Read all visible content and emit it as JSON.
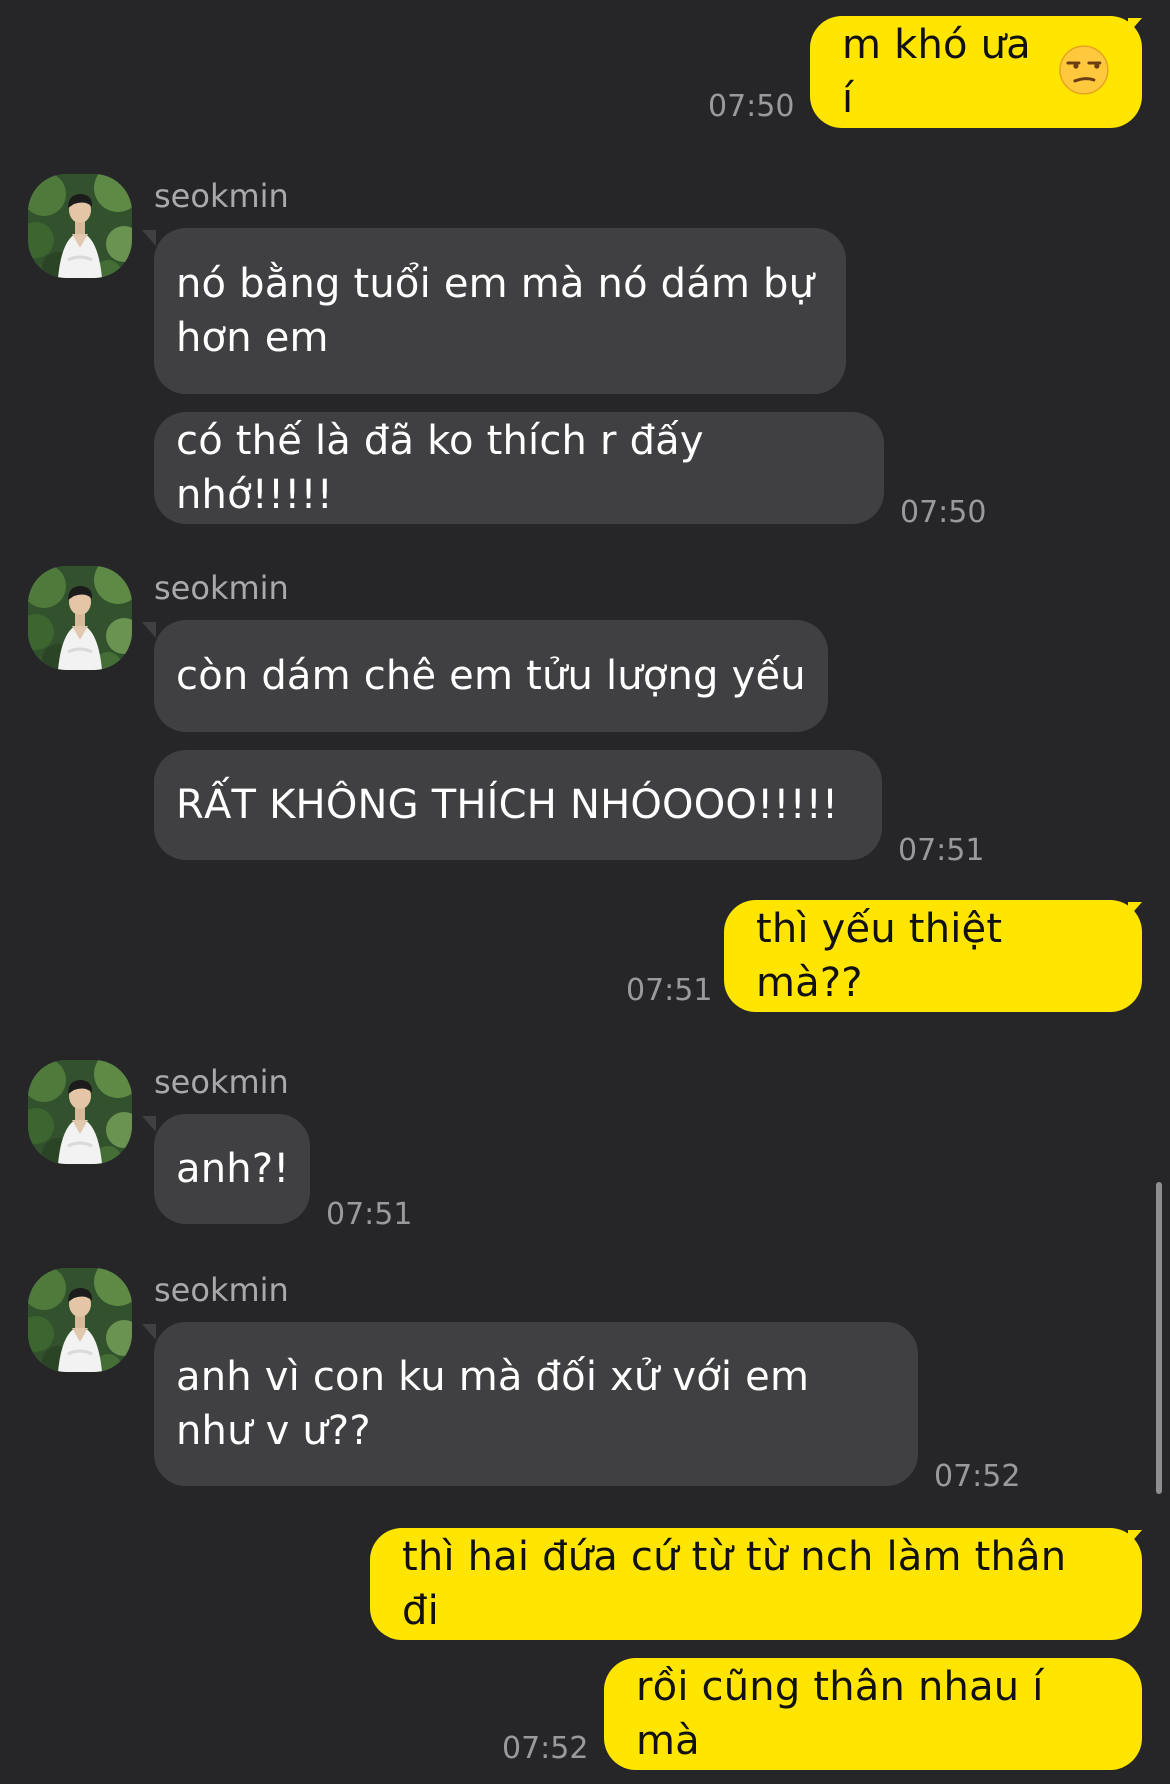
{
  "contact": {
    "name": "seokmin",
    "avatar_icon": "profile-photo-man-white-shirt"
  },
  "colors": {
    "background": "#262628",
    "incoming_bubble": "#404042",
    "outgoing_bubble": "#ffe500",
    "timestamp": "#9a9a9c"
  },
  "messages": [
    {
      "from": "me",
      "text": "m khó ưa í",
      "emoji": "unamused-face-icon",
      "time": "07:50"
    },
    {
      "from": "contact",
      "sender": "seokmin",
      "text": "nó bằng tuổi em mà nó dám bự hơn em"
    },
    {
      "from": "contact",
      "text": "có thế là đã ko thích r đấy nhớ!!!!!",
      "time": "07:50"
    },
    {
      "from": "contact",
      "sender": "seokmin",
      "text": "còn dám chê em tửu lượng yếu"
    },
    {
      "from": "contact",
      "text": "RẤT KHÔNG THÍCH NHÓOOO!!!!!",
      "time": "07:51"
    },
    {
      "from": "me",
      "text": "thì yếu thiệt mà??",
      "time": "07:51"
    },
    {
      "from": "contact",
      "sender": "seokmin",
      "text": "anh?!",
      "time": "07:51"
    },
    {
      "from": "contact",
      "sender": "seokmin",
      "text": "anh vì con ku mà đối xử với em như v ư??",
      "time": "07:52"
    },
    {
      "from": "me",
      "text": "thì hai đứa cứ từ từ nch làm thân đi"
    },
    {
      "from": "me",
      "text": "rồi cũng thân nhau í mà",
      "time": "07:52"
    }
  ]
}
